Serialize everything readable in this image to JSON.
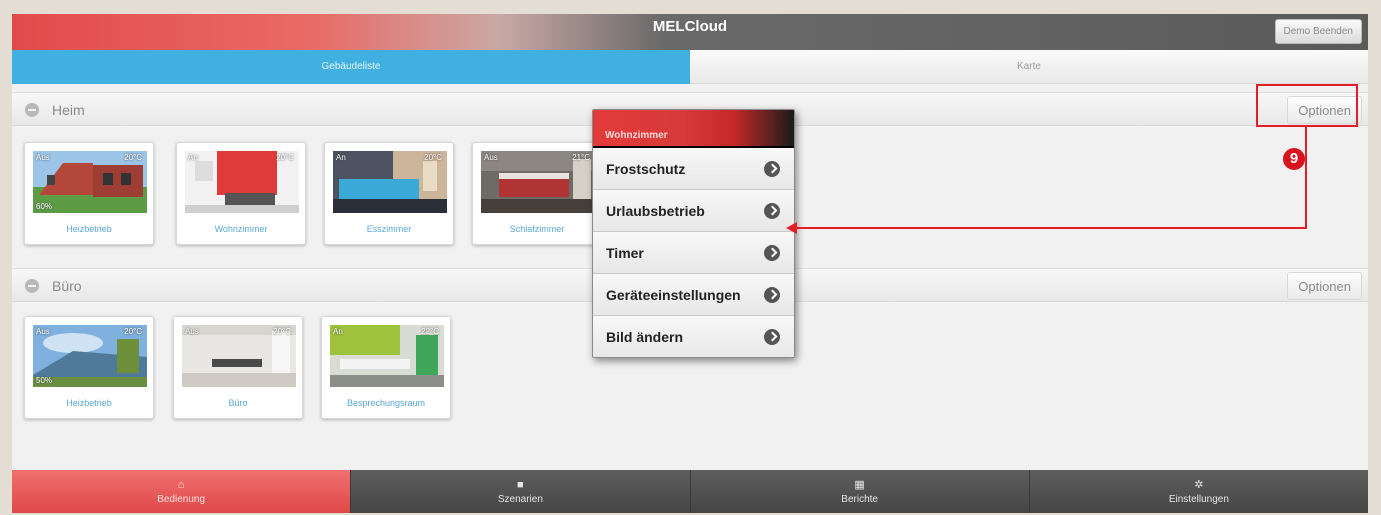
{
  "header": {
    "title": "MELCloud",
    "demo_button": "Demo Beenden"
  },
  "tabs": [
    {
      "label": "Gebäudeliste",
      "active": true
    },
    {
      "label": "Karte",
      "active": false
    }
  ],
  "sections": [
    {
      "name": "Heim",
      "options_label": "Optionen",
      "tiles": [
        {
          "label": "Heizbetrieb",
          "status": "Aus",
          "temp": "20°C",
          "humidity": "60%"
        },
        {
          "label": "Wohnzimmer",
          "status": "An",
          "temp": "20°C"
        },
        {
          "label": "Esszimmer",
          "status": "An",
          "temp": "20°C"
        },
        {
          "label": "Schlafzimmer",
          "status": "Aus",
          "temp": "21°C"
        }
      ]
    },
    {
      "name": "Büro",
      "options_label": "Optionen",
      "tiles": [
        {
          "label": "Heizbetrieb",
          "status": "Aus",
          "temp": "20°C",
          "humidity": "50%"
        },
        {
          "label": "Büro",
          "status": "Aus",
          "temp": "20°C"
        },
        {
          "label": "Besprechungsraum",
          "status": "An",
          "temp": "22°C"
        }
      ]
    }
  ],
  "popup_menu": {
    "title": "Wohnzimmer",
    "items": [
      "Frostschutz",
      "Urlaubsbetrieb",
      "Timer",
      "Geräteeinstellungen",
      "Bild ändern"
    ]
  },
  "annotation": {
    "badge": "9"
  },
  "bottom_nav": [
    {
      "label": "Bedienung",
      "icon": "home-icon",
      "active": true
    },
    {
      "label": "Szenarien",
      "icon": "video-icon",
      "active": false
    },
    {
      "label": "Berichte",
      "icon": "grid-icon",
      "active": false
    },
    {
      "label": "Einstellungen",
      "icon": "gear-icon",
      "active": false
    }
  ],
  "colors": {
    "accent_red": "#e04848",
    "tab_blue": "#3fb0e0",
    "annotation_red": "#e01f26"
  }
}
